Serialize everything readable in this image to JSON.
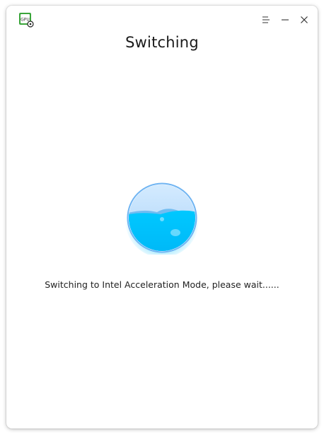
{
  "app": {
    "icon": "gpu-app-icon",
    "icon_text": "GPU"
  },
  "titlebar": {
    "menu_icon": "menu-icon",
    "minimize_icon": "minimize-icon",
    "close_icon": "close-icon"
  },
  "main": {
    "title": "Switching",
    "status": "Switching to Intel Acceleration Mode, please wait......",
    "progress_icon": "water-orb-icon",
    "water_color": "#00c0ff",
    "accent_color": "#5aa9f0"
  }
}
